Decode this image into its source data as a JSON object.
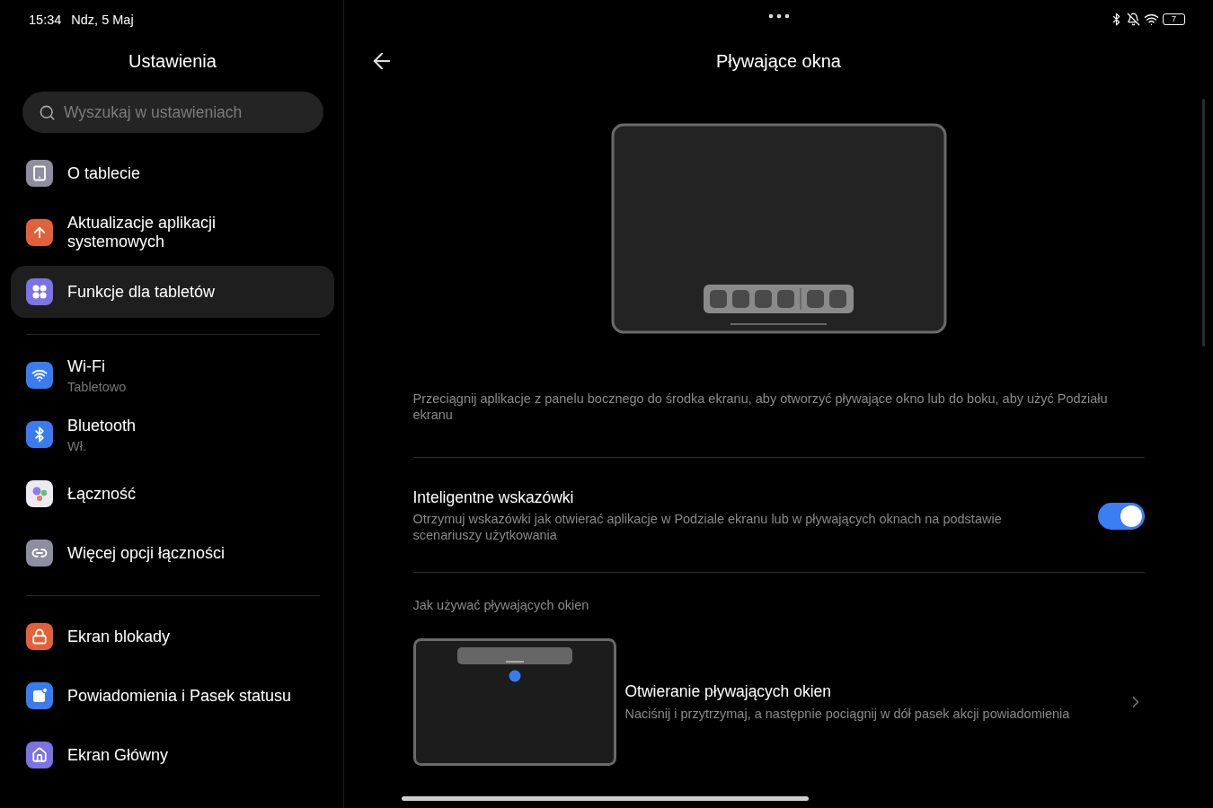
{
  "status_bar": {
    "time": "15:34",
    "date": "Ndz, 5 Maj",
    "battery": "7"
  },
  "sidebar": {
    "title": "Ustawienia",
    "search": {
      "placeholder": "Wyszukaj w ustawieniach"
    },
    "groups": [
      [
        {
          "kind": "tablet",
          "label": "O tablecie",
          "color": "#8e8ea0",
          "selected": false
        },
        {
          "kind": "update",
          "label": "Aktualizacje aplikacji systemowych",
          "color": "#e2603a",
          "selected": false
        },
        {
          "kind": "features",
          "label": "Funkcje dla tabletów",
          "color": "#7d72e6",
          "selected": true
        }
      ],
      [
        {
          "kind": "wifi",
          "label": "Wi-Fi",
          "subtitle": "Tabletowo",
          "color": "#3a7cf0",
          "selected": false
        },
        {
          "kind": "bluetooth",
          "label": "Bluetooth",
          "subtitle": "Wł.",
          "color": "#3a7cf0",
          "selected": false
        },
        {
          "kind": "connection",
          "label": "Łączność",
          "color": "#ecebf2",
          "selected": false
        },
        {
          "kind": "link",
          "label": "Więcej opcji łączności",
          "color": "#8e8ea0",
          "selected": false
        }
      ],
      [
        {
          "kind": "lock",
          "label": "Ekran blokady",
          "color": "#e2603a",
          "selected": false
        },
        {
          "kind": "notification",
          "label": "Powiadomienia i Pasek statusu",
          "color": "#3a7cf0",
          "selected": false
        },
        {
          "kind": "home",
          "label": "Ekran Główny",
          "color": "#7d72e6",
          "selected": false
        }
      ]
    ]
  },
  "page": {
    "title": "Pływające okna",
    "description": "Przeciągnij aplikacje z panelu bocznego do środka ekranu, aby otworzyć pływające okno lub do boku, aby użyć Podziału ekranu",
    "setting": {
      "title": "Inteligentne wskazówki",
      "description": "Otrzymuj wskazówki jak otwierać aplikacje w Podziale ekranu lub w pływających oknach na podstawie scenariuszy użytkowania",
      "on": true
    },
    "section_label": "Jak używać pływających okien",
    "tutorials": [
      {
        "title": "Otwieranie pływających okien",
        "description": "Naciśnij i przytrzymaj, a następnie pociągnij w dół pasek akcji powiadomienia"
      }
    ]
  }
}
